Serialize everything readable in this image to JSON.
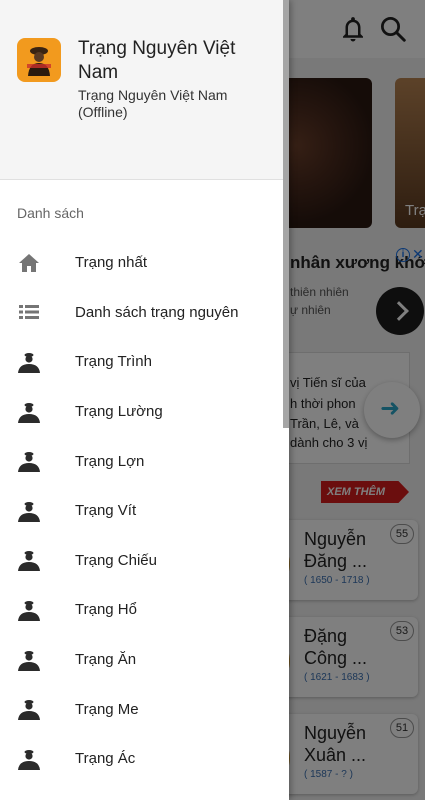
{
  "app": {
    "title": "Trạng Nguyên Việt Nam",
    "subtitle": "Trạng Nguyên Việt Nam (Offline)"
  },
  "drawer": {
    "section_title": "Danh sách",
    "items": [
      {
        "label": "Trạng nhất",
        "icon": "home-icon"
      },
      {
        "label": "Danh sách trạng nguyên",
        "icon": "list-icon"
      },
      {
        "label": "Trạng Trình",
        "icon": "person-icon"
      },
      {
        "label": "Trạng Lường",
        "icon": "person-icon"
      },
      {
        "label": "Trạng Lợn",
        "icon": "person-icon"
      },
      {
        "label": "Trạng Vít",
        "icon": "person-icon"
      },
      {
        "label": "Trạng Chiếu",
        "icon": "person-icon"
      },
      {
        "label": "Trạng Hổ",
        "icon": "person-icon"
      },
      {
        "label": "Trạng Ăn",
        "icon": "person-icon"
      },
      {
        "label": "Trạng Me",
        "icon": "person-icon"
      },
      {
        "label": "Trạng Ác",
        "icon": "person-icon"
      }
    ]
  },
  "background": {
    "top_icons": [
      "bell-icon",
      "search-icon"
    ],
    "card_label": "Trạ",
    "ad": {
      "title": "nhân xương khớ",
      "info_icon": "i",
      "close_icon": "✕",
      "line1": "thiên nhiên",
      "line2": "ự nhiên"
    },
    "text_lines": [
      "vị Tiến sĩ của",
      "h thời phon",
      "Trần, Lê, và",
      "dành cho 3 vị"
    ],
    "more_button": "XEM THÊM",
    "people": [
      {
        "name": "Nguyễn Đăng ...",
        "years": "( 1650 - 1718 )",
        "rank": "55"
      },
      {
        "name": "Đặng Công ...",
        "years": "( 1621 - 1683 )",
        "rank": "53"
      },
      {
        "name": "Nguyễn Xuân ...",
        "years": "( 1587 - ? )",
        "rank": "51"
      }
    ]
  },
  "colors": {
    "logo_orange": "#f29a1e",
    "more_red": "#d71c1c",
    "years_blue": "#3a6fb0"
  }
}
